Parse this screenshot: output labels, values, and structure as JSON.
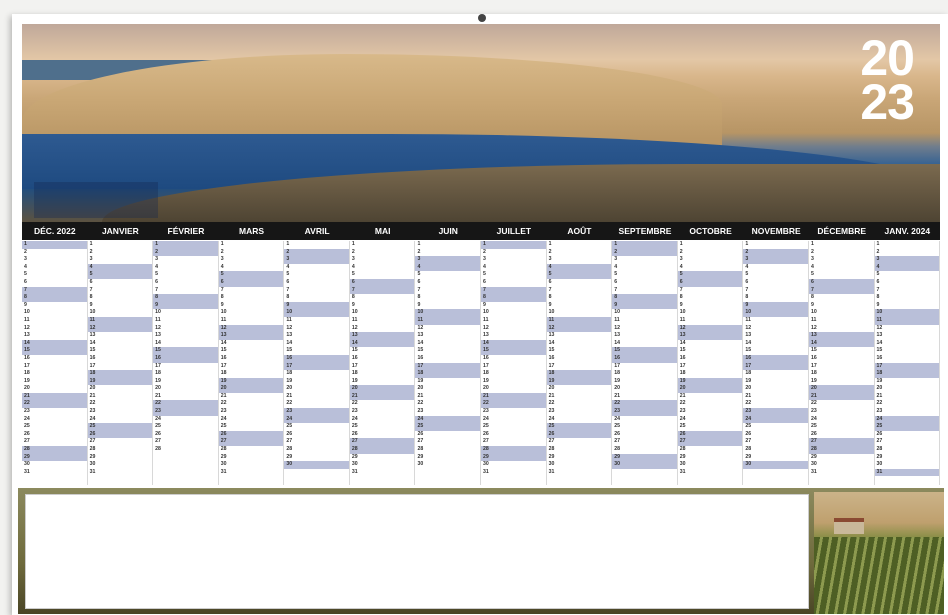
{
  "calendar": {
    "year_top": "20",
    "year_bottom": "23",
    "months": [
      "DÉC. 2022",
      "JANVIER",
      "FÉVRIER",
      "MARS",
      "AVRIL",
      "MAI",
      "JUIN",
      "JUILLET",
      "AOÛT",
      "SEPTEMBRE",
      "OCTOBRE",
      "NOVEMBRE",
      "DÉCEMBRE",
      "JANV. 2024"
    ],
    "days_in_month": [
      31,
      31,
      28,
      31,
      30,
      31,
      30,
      31,
      31,
      30,
      31,
      30,
      31,
      31
    ]
  }
}
